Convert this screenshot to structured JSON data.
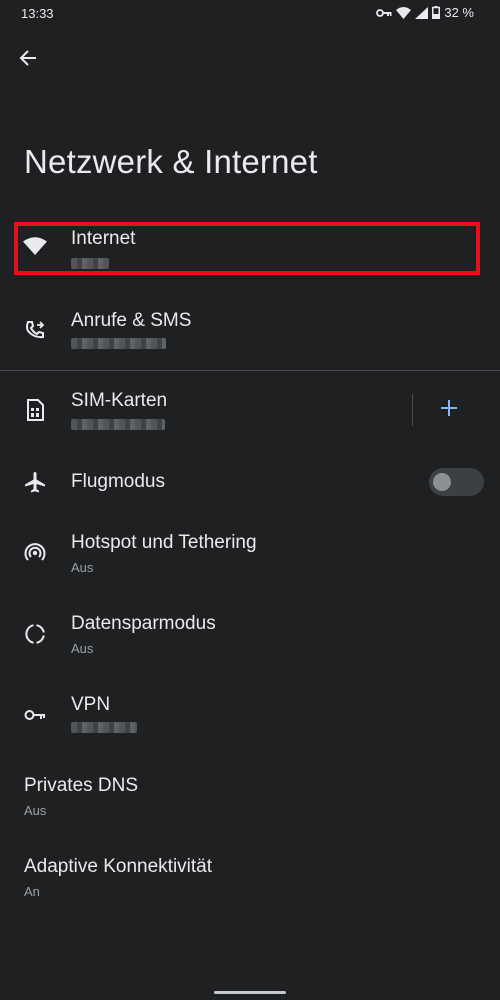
{
  "status_bar": {
    "time": "13:33",
    "battery": "32 %"
  },
  "page": {
    "title": "Netzwerk & Internet"
  },
  "items": {
    "internet": {
      "title": "Internet"
    },
    "calls": {
      "title": "Anrufe & SMS"
    },
    "sim": {
      "title": "SIM-Karten"
    },
    "airplane": {
      "title": "Flugmodus",
      "toggle_on": false
    },
    "hotspot": {
      "title": "Hotspot und Tethering",
      "subtitle": "Aus"
    },
    "datasaver": {
      "title": "Datensparmodus",
      "subtitle": "Aus"
    },
    "vpn": {
      "title": "VPN"
    },
    "private_dns": {
      "title": "Privates DNS",
      "subtitle": "Aus"
    },
    "adaptive": {
      "title": "Adaptive Konnektivität",
      "subtitle": "An"
    }
  },
  "icons": {
    "back": "arrow-back-icon",
    "internet": "wifi-icon",
    "calls": "phone-forward-icon",
    "sim": "sim-card-icon",
    "airplane": "airplane-icon",
    "hotspot": "hotspot-icon",
    "datasaver": "data-saver-icon",
    "vpn": "vpn-key-icon",
    "add": "plus-icon"
  },
  "colors": {
    "background": "#1f2022",
    "accent": "#8ab4f8",
    "highlight": "#e3111b"
  }
}
